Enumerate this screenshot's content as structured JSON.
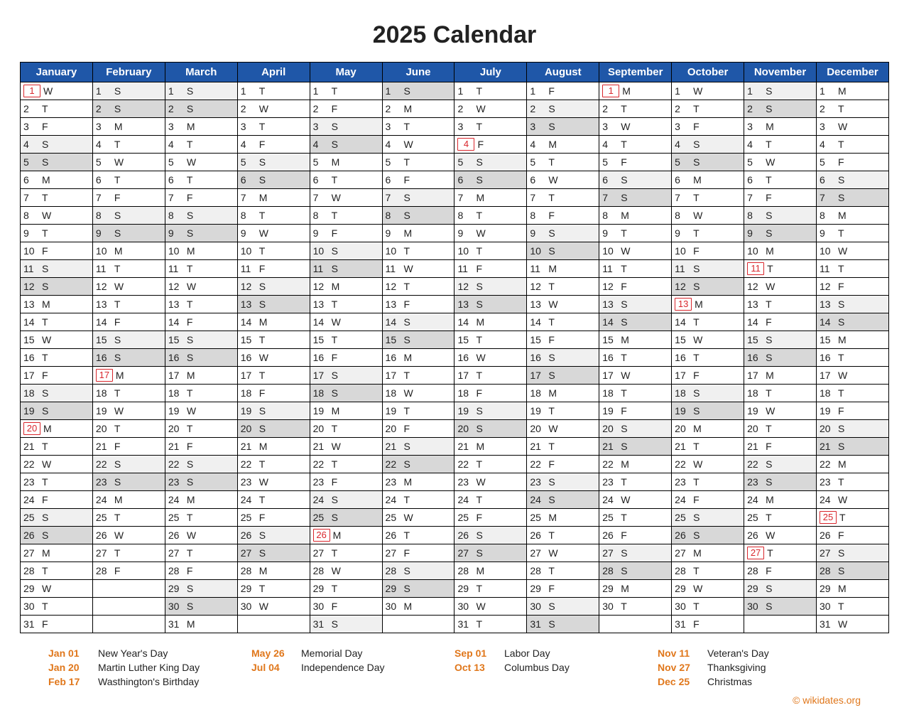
{
  "title": "2025 Calendar",
  "credit": "© wikidates.org",
  "months": [
    "January",
    "February",
    "March",
    "April",
    "May",
    "June",
    "July",
    "August",
    "September",
    "October",
    "November",
    "December"
  ],
  "startWeekday": [
    3,
    6,
    6,
    2,
    4,
    0,
    2,
    5,
    1,
    3,
    6,
    1
  ],
  "daysInMonth": [
    31,
    28,
    31,
    30,
    31,
    30,
    31,
    31,
    30,
    31,
    30,
    31
  ],
  "weekdayLetters": [
    "S",
    "M",
    "T",
    "W",
    "T",
    "F",
    "S"
  ],
  "holidayDays": {
    "0": [
      1,
      20
    ],
    "1": [
      17
    ],
    "4": [
      26
    ],
    "6": [
      4
    ],
    "8": [
      1
    ],
    "9": [
      13
    ],
    "10": [
      11,
      27
    ],
    "11": [
      25
    ]
  },
  "holidays": [
    [
      {
        "date": "Jan 01",
        "name": "New Year's Day"
      },
      {
        "date": "Jan 20",
        "name": "Martin Luther King Day"
      },
      {
        "date": "Feb 17",
        "name": "Wasthington's Birthday"
      }
    ],
    [
      {
        "date": "May 26",
        "name": "Memorial Day"
      },
      {
        "date": "Jul 04",
        "name": "Independence Day"
      }
    ],
    [
      {
        "date": "Sep 01",
        "name": "Labor Day"
      },
      {
        "date": "Oct 13",
        "name": "Columbus Day"
      }
    ],
    [
      {
        "date": "Nov 11",
        "name": "Veteran's Day"
      },
      {
        "date": "Nov 27",
        "name": "Thanksgiving"
      },
      {
        "date": "Dec 25",
        "name": "Christmas"
      }
    ]
  ]
}
